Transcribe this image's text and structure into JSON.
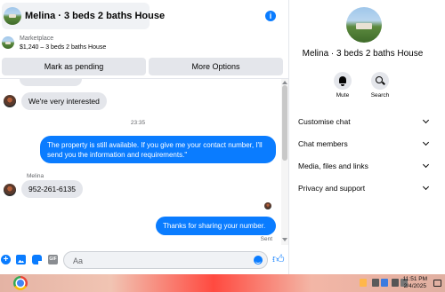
{
  "header": {
    "title": "Melina · 3 beds 2 baths House"
  },
  "marketplace": {
    "source": "Marketplace",
    "listing": "$1,240 – 3 beds 2 baths House"
  },
  "actions": {
    "pending_label": "Mark as pending",
    "more_label": "More Options"
  },
  "messages": {
    "incoming_1": "We're very interested",
    "timestamp": "23:35",
    "outgoing_1": "The property is still available. If you give me your contact number, I'll send you the information and requirements.\"",
    "sender_name": "Melina",
    "incoming_2": "952-261-6135",
    "outgoing_2": "Thanks for sharing your number.",
    "status": "Sent"
  },
  "composer": {
    "placeholder": "Aa"
  },
  "panel": {
    "title": "Melina · 3 beds 2 baths House",
    "mute_label": "Mute",
    "search_label": "Search",
    "menu": [
      {
        "label": "Customise chat"
      },
      {
        "label": "Chat members"
      },
      {
        "label": "Media, files and links"
      },
      {
        "label": "Privacy and support"
      }
    ]
  },
  "taskbar": {
    "time": "11:51 PM",
    "date": "2/4/2025"
  },
  "colors": {
    "accent": "#0a7cff",
    "bubble_in": "#e4e6eb"
  },
  "icons": [
    "info-icon",
    "plus-icon",
    "photo-icon",
    "sticker-icon",
    "gif-icon",
    "emoji-icon",
    "thumbs-up-icon",
    "bell-icon",
    "search-icon",
    "chevron-down-icon",
    "chrome-icon"
  ]
}
